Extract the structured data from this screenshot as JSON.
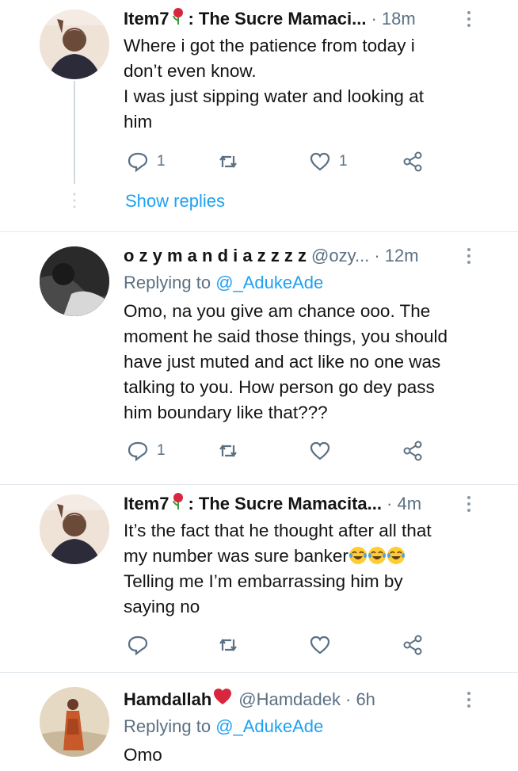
{
  "tweets": [
    {
      "name": "Item7",
      "display_suffix": ": The Sucre Mamaci...",
      "handle": "",
      "time": "· 18m",
      "replying_prefix": "",
      "replying_handle": "",
      "lines": [
        "Where i got the patience from today i",
        "don’t even know.",
        "I was just sipping water and looking at",
        "him"
      ],
      "reply_count": "1",
      "retweet_count": "",
      "like_count": "1"
    },
    {
      "name": "o z y m a n d i a z z z z",
      "display_suffix": "",
      "handle": "@ozy...",
      "time": "· 12m",
      "replying_prefix": "Replying to ",
      "replying_handle": "@_AdukeAde",
      "lines": [
        "Omo, na you give am chance ooo. The",
        "moment he said those things, you should",
        "have just muted and act like no one was",
        "talking to you. How person go dey pass",
        "him boundary like that???"
      ],
      "reply_count": "1",
      "retweet_count": "",
      "like_count": ""
    },
    {
      "name": "Item7",
      "display_suffix": ": The Sucre Mamacita...",
      "handle": "",
      "time": "· 4m",
      "replying_prefix": "",
      "replying_handle": "",
      "lines": [
        "It’s the fact that he thought after all that",
        "my number was sure banker",
        "Telling me I’m embarrassing him by",
        "saying no"
      ],
      "reply_count": "",
      "retweet_count": "",
      "like_count": ""
    },
    {
      "name": "Hamdallah",
      "display_suffix": "",
      "handle": "@Hamdadek",
      "time": "· 6h",
      "replying_prefix": "Replying to ",
      "replying_handle": "@_AdukeAde",
      "lines": [
        "Omo"
      ],
      "reply_count": "",
      "retweet_count": "",
      "like_count": ""
    }
  ],
  "show_replies": "Show replies",
  "colors": {
    "link": "#1da1f2",
    "secondary": "#5b7083",
    "text": "#141414",
    "heart": "#e0245e"
  },
  "icons": [
    "reply-icon",
    "retweet-icon",
    "like-icon",
    "share-icon",
    "more-icon",
    "rose-icon",
    "heart-icon",
    "laughing-emoji"
  ]
}
